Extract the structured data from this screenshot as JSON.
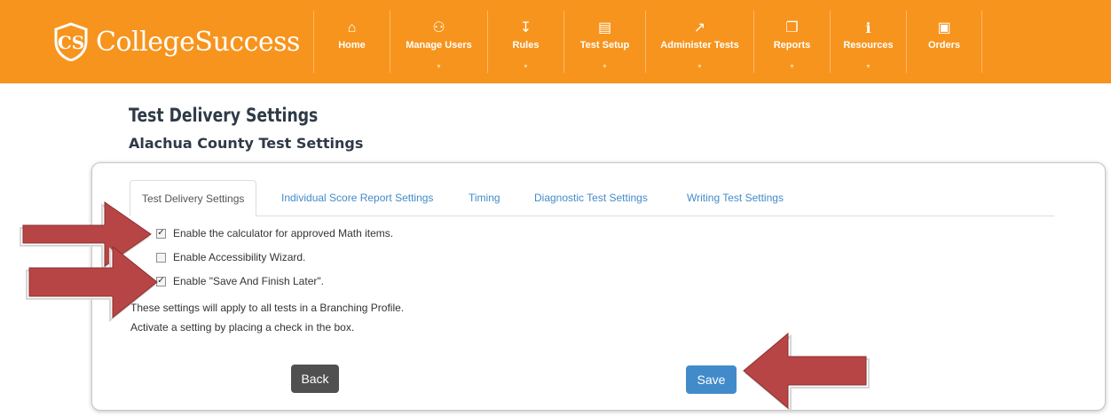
{
  "brand": {
    "name": "CollegeSuccess",
    "accent": "#f7941d"
  },
  "nav": [
    {
      "label": "Home",
      "icon": "home-icon",
      "glyph": "⌂",
      "caret": false
    },
    {
      "label": "Manage Users",
      "icon": "users-icon",
      "glyph": "⚇",
      "caret": true
    },
    {
      "label": "Rules",
      "icon": "sort-list-icon",
      "glyph": "↧",
      "caret": true
    },
    {
      "label": "Test Setup",
      "icon": "book-icon",
      "glyph": "▤",
      "caret": true
    },
    {
      "label": "Administer Tests",
      "icon": "external-link-icon",
      "glyph": "↗",
      "caret": true
    },
    {
      "label": "Reports",
      "icon": "copy-icon",
      "glyph": "❐",
      "caret": true
    },
    {
      "label": "Resources",
      "icon": "info-icon",
      "glyph": "i",
      "caret": true
    },
    {
      "label": "Orders",
      "icon": "cart-icon",
      "glyph": "▣",
      "caret": false
    }
  ],
  "page": {
    "title": "Test Delivery Settings",
    "subtitle": "Alachua County Test Settings"
  },
  "tabs": [
    {
      "label": "Test Delivery Settings",
      "active": true
    },
    {
      "label": "Individual Score Report Settings",
      "active": false
    },
    {
      "label": "Timing",
      "active": false
    },
    {
      "label": "Diagnostic Test Settings",
      "active": false
    },
    {
      "label": "Writing Test Settings",
      "active": false
    }
  ],
  "options": [
    {
      "label": "Enable the calculator for approved Math items.",
      "checked": true
    },
    {
      "label": "Enable Accessibility Wizard.",
      "checked": false
    },
    {
      "label": "Enable \"Save And Finish Later\".",
      "checked": true
    }
  ],
  "notes": [
    "These settings will apply to all tests in a Branching Profile.",
    "Activate a setting by placing a check in the box."
  ],
  "buttons": {
    "back": "Back",
    "save": "Save"
  },
  "annotation_color": "#b84545"
}
